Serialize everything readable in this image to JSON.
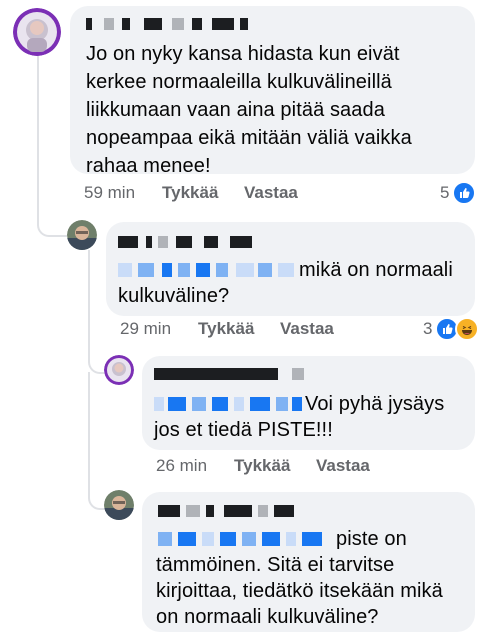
{
  "comments": [
    {
      "text": "Jo on nyky kansa hidasta kun eivät kerkee normaaleilla kulkuvälineillä liikkumaan vaan aina pitää saada nopeampaa eikä mitään väliä vaikka rahaa menee!",
      "lines": [
        "Jo on nyky kansa hidasta kun eivät",
        "kerkee normaaleilla kulkuvälineillä",
        "liikkumaan vaan aina pitää saada",
        "nopeampaa eikä mitään väliä vaikka",
        "rahaa menee!"
      ],
      "time": "59 min",
      "like_label": "Tykkää",
      "reply_label": "Vastaa",
      "reaction_count": "5",
      "reaction_icons": [
        "like-icon"
      ]
    },
    {
      "lines": [
        "mikä on normaali",
        "kulkuväline?"
      ],
      "time": "29 min",
      "like_label": "Tykkää",
      "reply_label": "Vastaa",
      "reaction_count": "3",
      "reaction_icons": [
        "like-icon",
        "haha-icon"
      ]
    },
    {
      "lines": [
        "Voi pyhä jysäys",
        "jos et tiedä PISTE!!!"
      ],
      "time": "26 min",
      "like_label": "Tykkää",
      "reply_label": "Vastaa"
    },
    {
      "lines": [
        "piste on",
        "tämmöinen. Sitä ei tarvitse",
        "kirjoittaa, tiedätkö itsekään mikä",
        "on normaali kulkuväline?"
      ]
    }
  ],
  "colors": {
    "bubble": "#f0f2f5",
    "meta_text": "#65676b",
    "link_blue": "#1877f2",
    "like_blue": "#1877f2",
    "haha_yellow": "#f7b125",
    "thread_line": "#dfe1e5"
  }
}
